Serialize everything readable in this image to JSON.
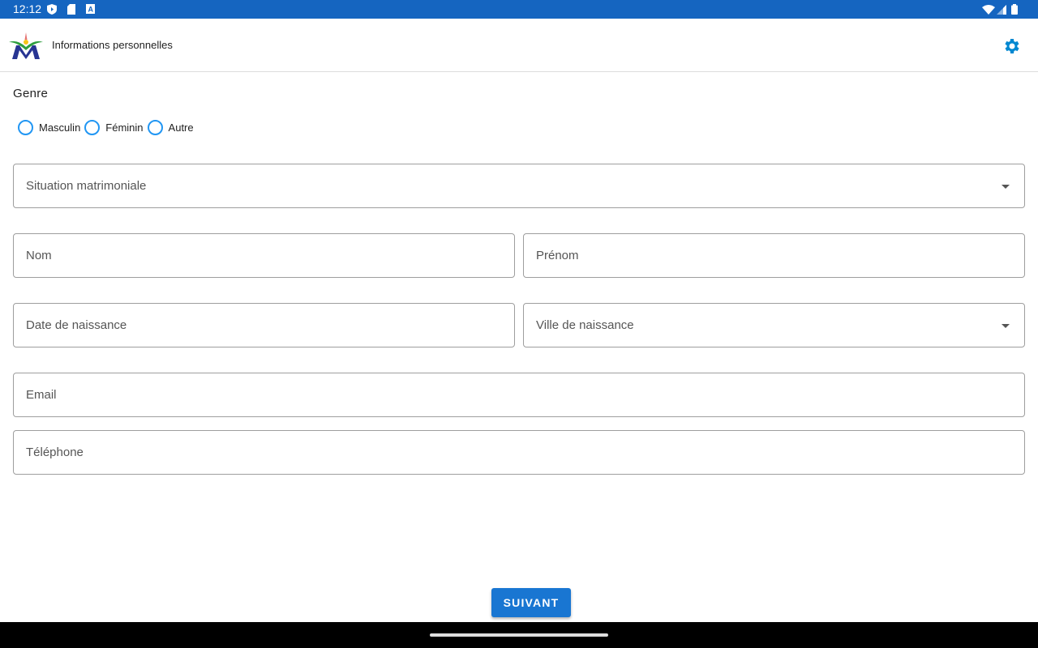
{
  "status_bar": {
    "time": "12:12"
  },
  "app_bar": {
    "title": "Informations personnelles"
  },
  "form": {
    "genre_label": "Genre",
    "genre_options": [
      "Masculin",
      "Féminin",
      "Autre"
    ],
    "fields": {
      "situation": "Situation matrimoniale",
      "nom": "Nom",
      "prenom": "Prénom",
      "date_naissance": "Date de naissance",
      "ville_naissance": "Ville de naissance",
      "email": "Email",
      "telephone": "Téléphone"
    },
    "next_label": "SUIVANT"
  },
  "colors": {
    "status_bar": "#1565c0",
    "accent": "#1976d2",
    "radio": "#2196f3",
    "gear": "#0288d1"
  }
}
